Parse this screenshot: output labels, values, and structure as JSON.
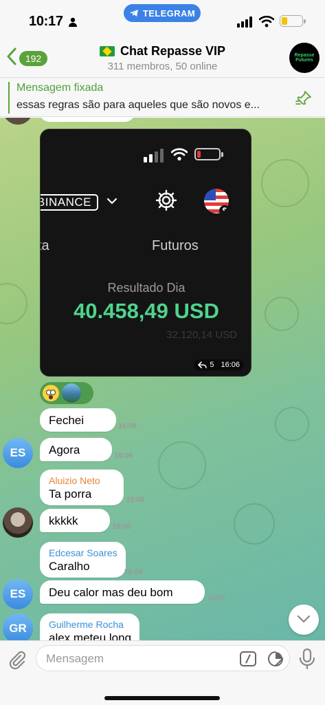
{
  "status_bar": {
    "time": "10:17",
    "app_pill": "TELEGRAM"
  },
  "header": {
    "back_count": "192",
    "title": "Chat Repasse VIP",
    "subtitle": "311 membros, 50 online",
    "avatar_text": "Repasse Futures"
  },
  "pinned": {
    "title": "Mensagem fixada",
    "text": "essas regras são para aqueles que são novos e..."
  },
  "media": {
    "exchange": "BINANCE",
    "tab_left": "ta",
    "tab_right": "Futuros",
    "label": "Resultado Dia",
    "value": "40.458,49 USD",
    "faded_text": "32.120,14 USD",
    "replies": "5",
    "time": "16:06"
  },
  "messages": [
    {
      "sender": "",
      "text": "Fechei",
      "time": "16:06"
    },
    {
      "sender": "",
      "text": "Agora",
      "time": "16:06",
      "avatar": "ES"
    },
    {
      "sender": "Aluizio Neto",
      "text": "Ta porra",
      "time": "16:06"
    },
    {
      "sender": "",
      "text": "kkkkk",
      "time": "16:06"
    },
    {
      "sender": "Edcesar Soares",
      "text": "Caralho",
      "time": "16:06"
    },
    {
      "sender": "",
      "text": "Deu calor mas deu bom",
      "time": "16:07",
      "avatar": "ES"
    },
    {
      "sender": "Guilherme Rocha",
      "text": "alex meteu long",
      "time": "",
      "avatar": "GR"
    }
  ],
  "input": {
    "placeholder": "Mensagem"
  },
  "colors": {
    "accent_green": "#5aa23a",
    "sender_orange": "#e8833a",
    "sender_blue": "#3b8fd6",
    "result_green": "#4fd48c"
  }
}
